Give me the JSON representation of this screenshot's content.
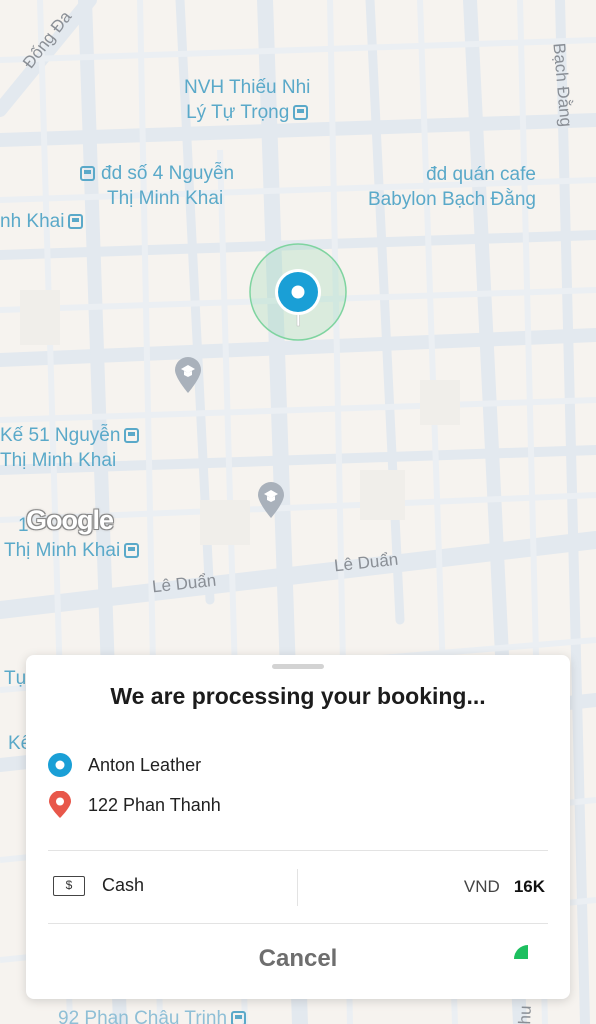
{
  "map": {
    "labels": [
      {
        "text": "NVH Thiếu Nhi",
        "line2": "Lý Tự Trọng"
      },
      {
        "text": "đd số 4 Nguyễn",
        "line2": "Thị Minh Khai"
      },
      {
        "text": "nh Khai"
      },
      {
        "text": "đd quán cafe",
        "line2": "Babylon Bạch Đằng"
      },
      {
        "text": "Kế 51 Nguyễn",
        "line2": "Thị Minh Khai"
      },
      {
        "text": "1",
        "line2": "Thị Minh Khai"
      },
      {
        "text": "92 Phan Châu Trinh"
      }
    ],
    "streets": {
      "dong_da": "Đống Đa",
      "bach_dang": "Bạch Đằng",
      "le_duan_1": "Lê Duẩn",
      "le_duan_2": "Lê Duẩn",
      "edge_1": "Tụ",
      "edge_2": "Kế",
      "edge_3": "hu"
    },
    "google": "Google"
  },
  "booking": {
    "title": "We are processing your booking...",
    "pickup": "Anton Leather",
    "dropoff": "122 Phan Thanh",
    "payment_method": "Cash",
    "payment_icon": "$",
    "currency": "VND",
    "amount": "16K",
    "cancel_label": "Cancel"
  },
  "colors": {
    "pickup": "#1a9fd6",
    "dropoff": "#e8574a",
    "pulse": "#5cc98a",
    "spinner": "#1dbf5f",
    "map_label": "#5aa9c9"
  },
  "icons": {
    "pickup": "pickup-dot-icon",
    "dropoff": "dropoff-pin-icon",
    "cash": "cash-icon",
    "poi": "school-icon",
    "bus": "bus-stop-icon"
  }
}
